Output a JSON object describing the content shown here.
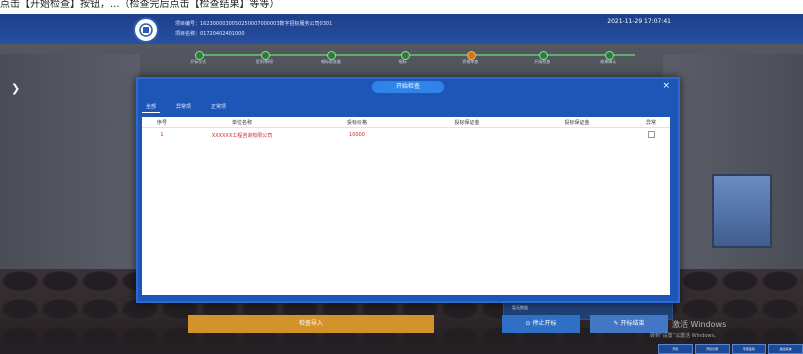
{
  "instruction": "点击【开始检查】按钮，...（检查完后点击【检查结果】等等）",
  "header": {
    "project_line1": "项目编号：1623000030050250007000003数字招标服务公司0301",
    "project_line2": "项目名称：01720402401000",
    "datetime": "2021-11-29  17:07:41"
  },
  "progress_steps": [
    "开标仪式",
    "签到/解密",
    "唱标前准备",
    "唱标",
    "资格审查",
    "开始检查",
    "结果确认"
  ],
  "modal": {
    "title": "开始检查",
    "close_glyph": "×",
    "tabs": [
      "全部",
      "异常项",
      "正常项"
    ],
    "columns": [
      "序号",
      "单位名称",
      "投标价格",
      "投标保证金",
      "投标保证金",
      "异常"
    ],
    "rows": [
      {
        "index": "1",
        "company": "XXXXXX工程咨询有限公司",
        "price": "10000",
        "margin": "",
        "margin2": "",
        "flag": ""
      }
    ]
  },
  "side_text": "暂无数据",
  "buttons": {
    "import": "检查导入",
    "stop": "⊙ 停止开标",
    "apply": "✎ 开标结束"
  },
  "watermark": {
    "title": "激活 Windows",
    "sub": "转到“设置”以激活 Windows。"
  },
  "taskbar": [
    "开标",
    "开标记录",
    "专家签到",
    "退出系统"
  ]
}
